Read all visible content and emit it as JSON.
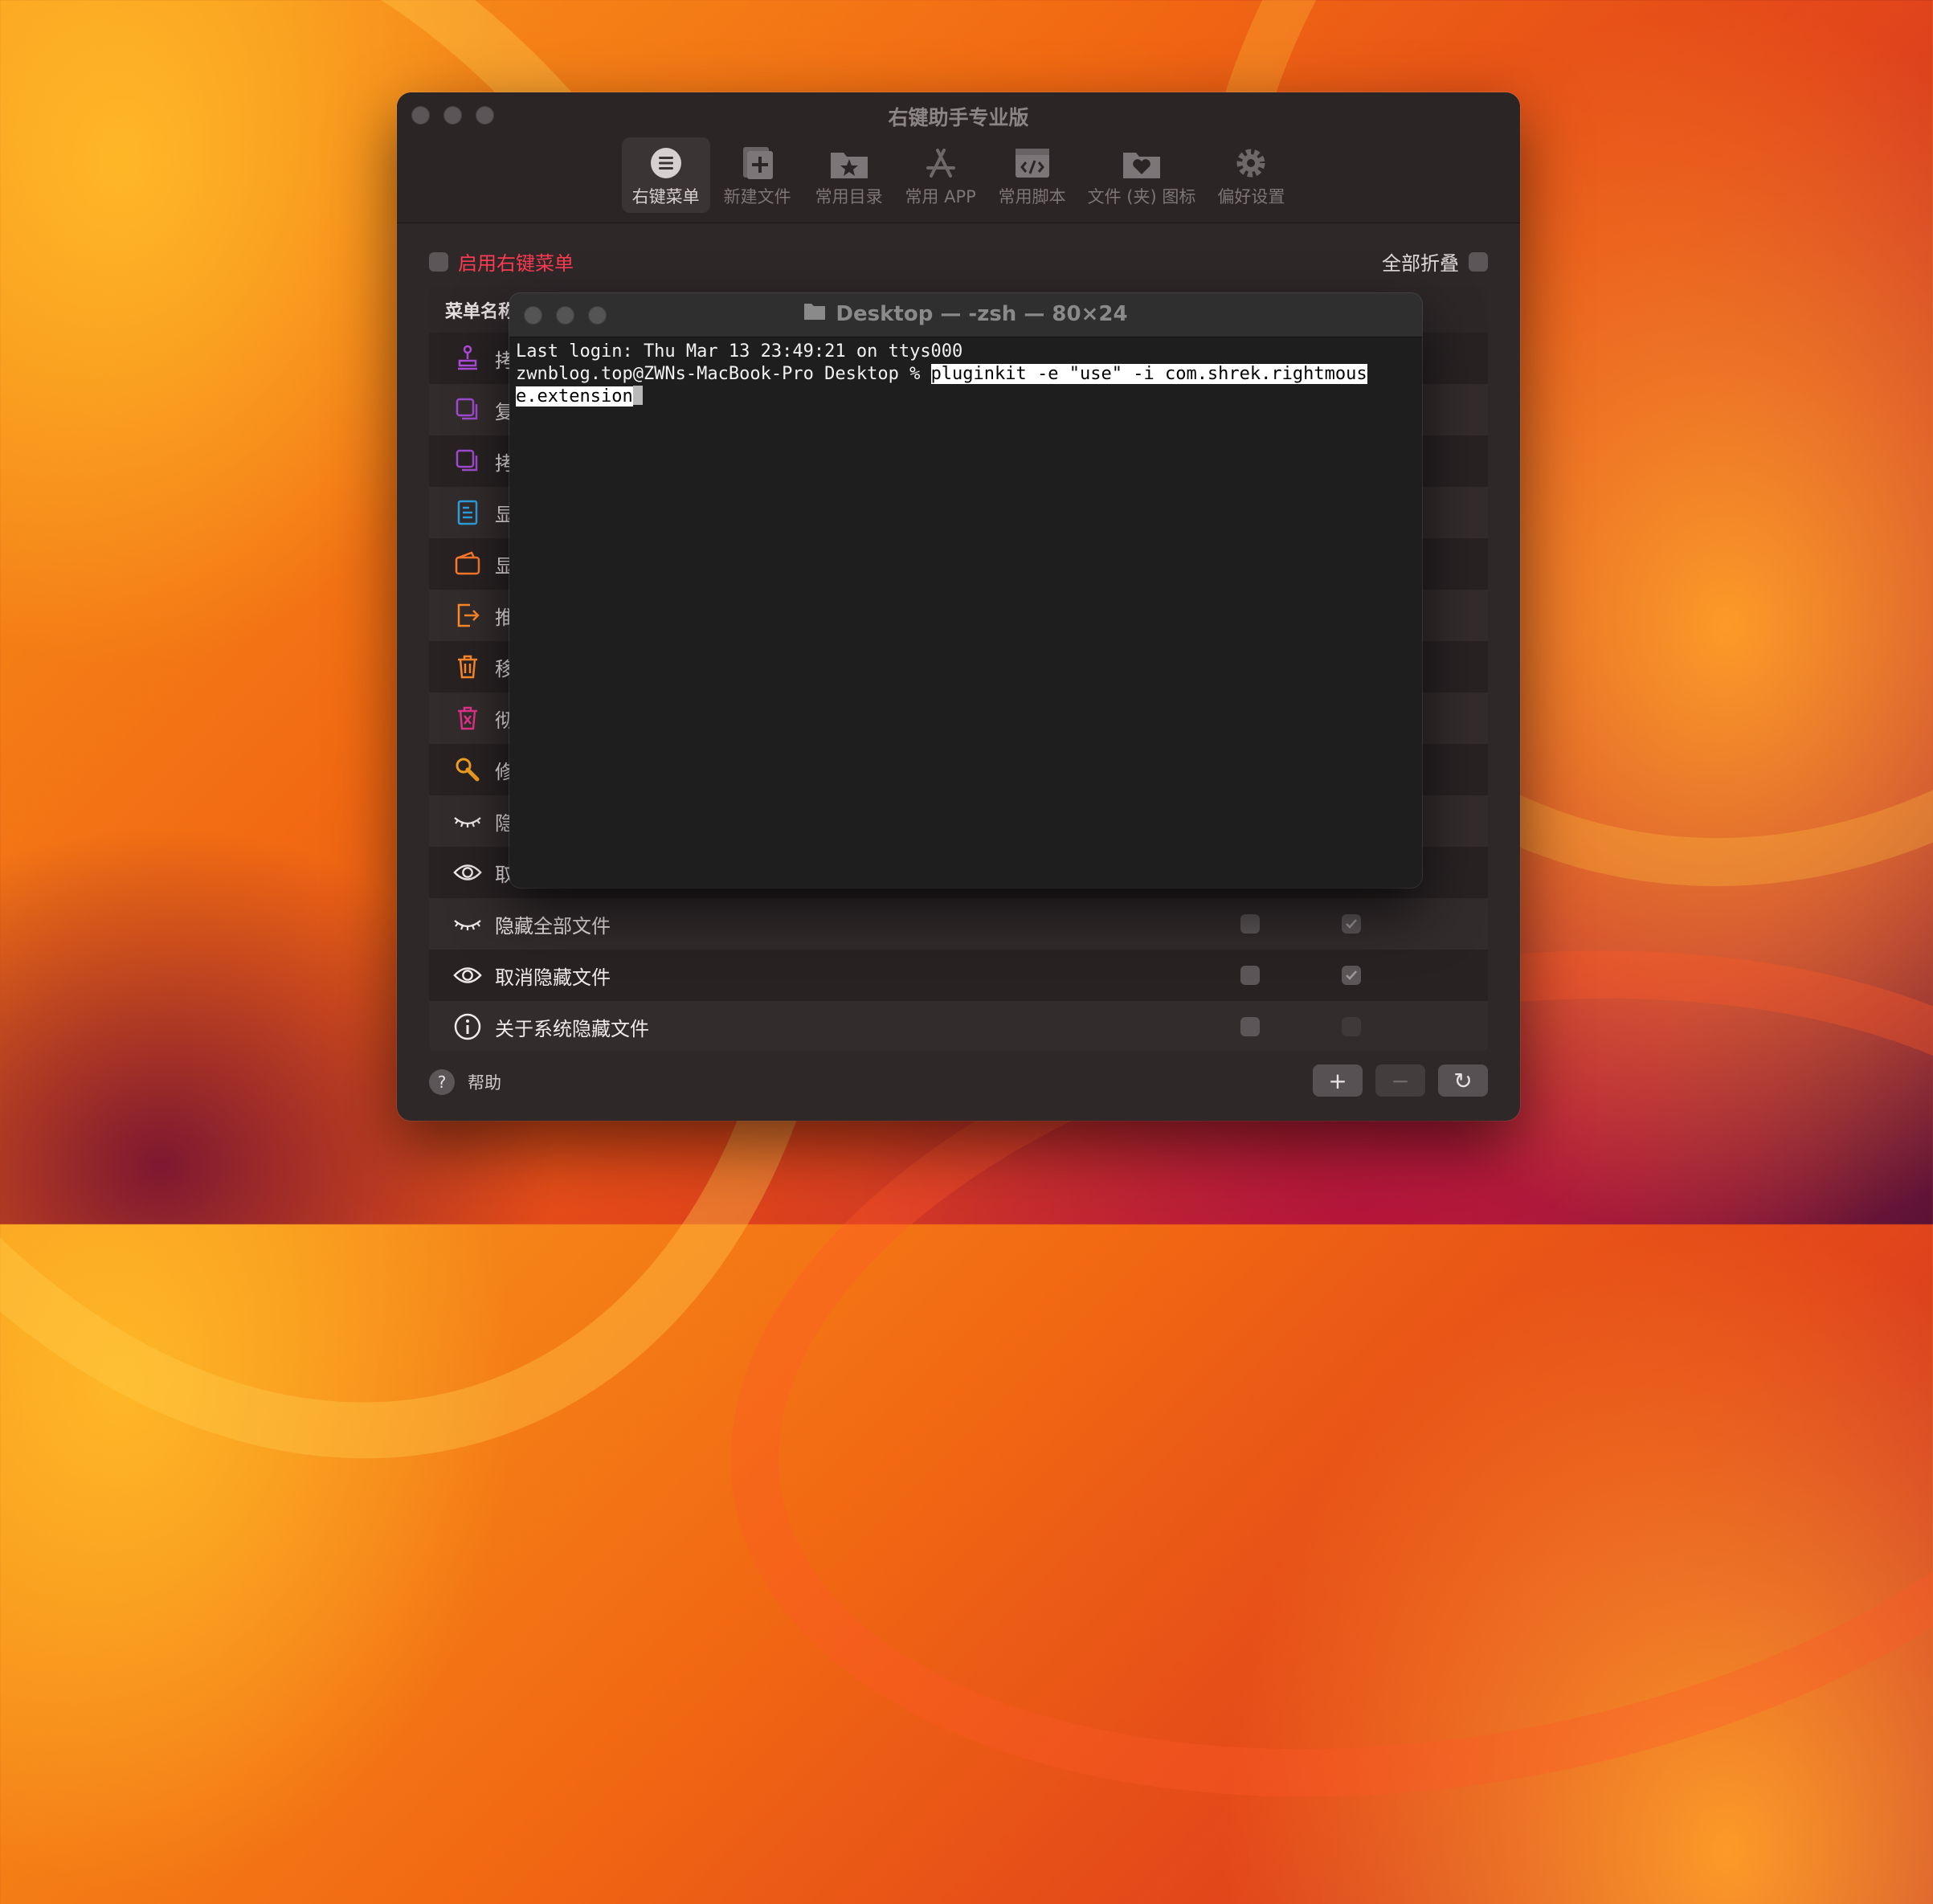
{
  "app": {
    "title": "右键助手专业版",
    "toolbar": [
      {
        "label": "右键菜单",
        "icon": "menu-list-icon"
      },
      {
        "label": "新建文件",
        "icon": "new-file-icon"
      },
      {
        "label": "常用目录",
        "icon": "folder-star-icon"
      },
      {
        "label": "常用 APP",
        "icon": "app-store-icon"
      },
      {
        "label": "常用脚本",
        "icon": "script-icon"
      },
      {
        "label": "文件 (夹) 图标",
        "icon": "folder-heart-icon"
      },
      {
        "label": "偏好设置",
        "icon": "gear-icon"
      }
    ],
    "enable_label": "启用右键菜单",
    "collapse_label": "全部折叠",
    "table_header": "菜单名称",
    "rows": [
      {
        "label": "拷",
        "icon": "stamp-icon",
        "color": "#b04cdc"
      },
      {
        "label": "复",
        "icon": "copy-icon",
        "color": "#a04cd0"
      },
      {
        "label": "拷",
        "icon": "copy-icon",
        "color": "#a04cd0"
      },
      {
        "label": "显",
        "icon": "document-icon",
        "color": "#2ea0e0"
      },
      {
        "label": "显",
        "icon": "wallet-icon",
        "color": "#ff7a2a"
      },
      {
        "label": "推",
        "icon": "exit-icon",
        "color": "#ff8a2a"
      },
      {
        "label": "移",
        "icon": "trash-icon",
        "color": "#ff8a2a"
      },
      {
        "label": "彻",
        "icon": "trash-x-icon",
        "color": "#e0348a"
      },
      {
        "label": "修",
        "icon": "wrench-icon",
        "color": "#f0a020"
      },
      {
        "label": "隐",
        "icon": "eye-closed-icon",
        "color": "#f0eaeb"
      },
      {
        "label": "取",
        "icon": "eye-icon",
        "color": "#f0eaeb"
      },
      {
        "label": "隐藏全部文件",
        "icon": "eye-closed-icon",
        "color": "#f0eaeb",
        "chk_a": false,
        "chk_b": true
      },
      {
        "label": "取消隐藏文件",
        "icon": "eye-icon",
        "color": "#f0eaeb",
        "chk_a": false,
        "chk_b": true
      },
      {
        "label": "关于系统隐藏文件",
        "icon": "info-icon",
        "color": "#f0eaeb",
        "chk_a": false,
        "chk_b": false
      }
    ],
    "help_label": "帮助",
    "buttons": {
      "add": "+",
      "remove": "−",
      "refresh": "↻"
    }
  },
  "terminal": {
    "title": "Desktop — -zsh — 80×24",
    "line1": "Last login: Thu Mar 13 23:49:21 on ttys000",
    "prompt": "zwnblog.top@ZWNs-MacBook-Pro Desktop % ",
    "command_part1": "pluginkit -e \"use\" -i com.shrek.rightmous",
    "command_part2": "e.extension"
  }
}
